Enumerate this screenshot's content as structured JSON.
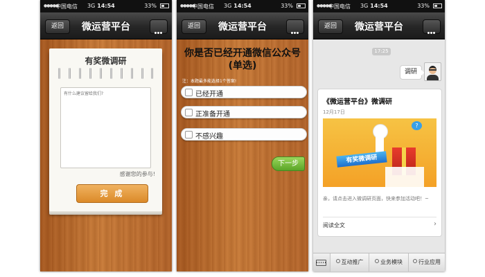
{
  "status_bar": {
    "signal": "●●●●●",
    "carrier": "中国电信",
    "network": "3G",
    "time": "14:54",
    "battery": "33%"
  },
  "nav": {
    "back_label": "返回",
    "title": "微运营平台"
  },
  "screen1": {
    "card_title": "有奖微调研",
    "textarea_placeholder": "有什么建议留给我们?",
    "thanks": "感谢您的参与!",
    "submit_label": "完 成"
  },
  "screen2": {
    "question_line1": "你是否已经开通微信公众号",
    "question_line2": "(单选)",
    "note": "注：本题最多能选择1个答案!",
    "options": [
      {
        "label": "已经开通"
      },
      {
        "label": "正准备开通"
      },
      {
        "label": "不感兴趣"
      }
    ],
    "next_label": "下一步"
  },
  "screen3": {
    "chat_time": "17:25",
    "message": "调研",
    "article": {
      "title": "《微运营平台》微调研",
      "date": "12月17日",
      "image_banner": "有奖微调研",
      "image_bubble": "?",
      "description": "亲，请点击进入微调研页面，快来参加活动吧！~",
      "read_more": "阅读全文",
      "chevron": "›"
    },
    "menu_tabs": [
      {
        "label": "互动推广"
      },
      {
        "label": "业务模块"
      },
      {
        "label": "行业应用"
      }
    ]
  },
  "colors": {
    "wood": "#b8672a",
    "nav_bar": "#262626",
    "submit_orange": "#e89a3a",
    "next_green": "#6cbb35",
    "banner_blue": "#1f6fcc"
  }
}
